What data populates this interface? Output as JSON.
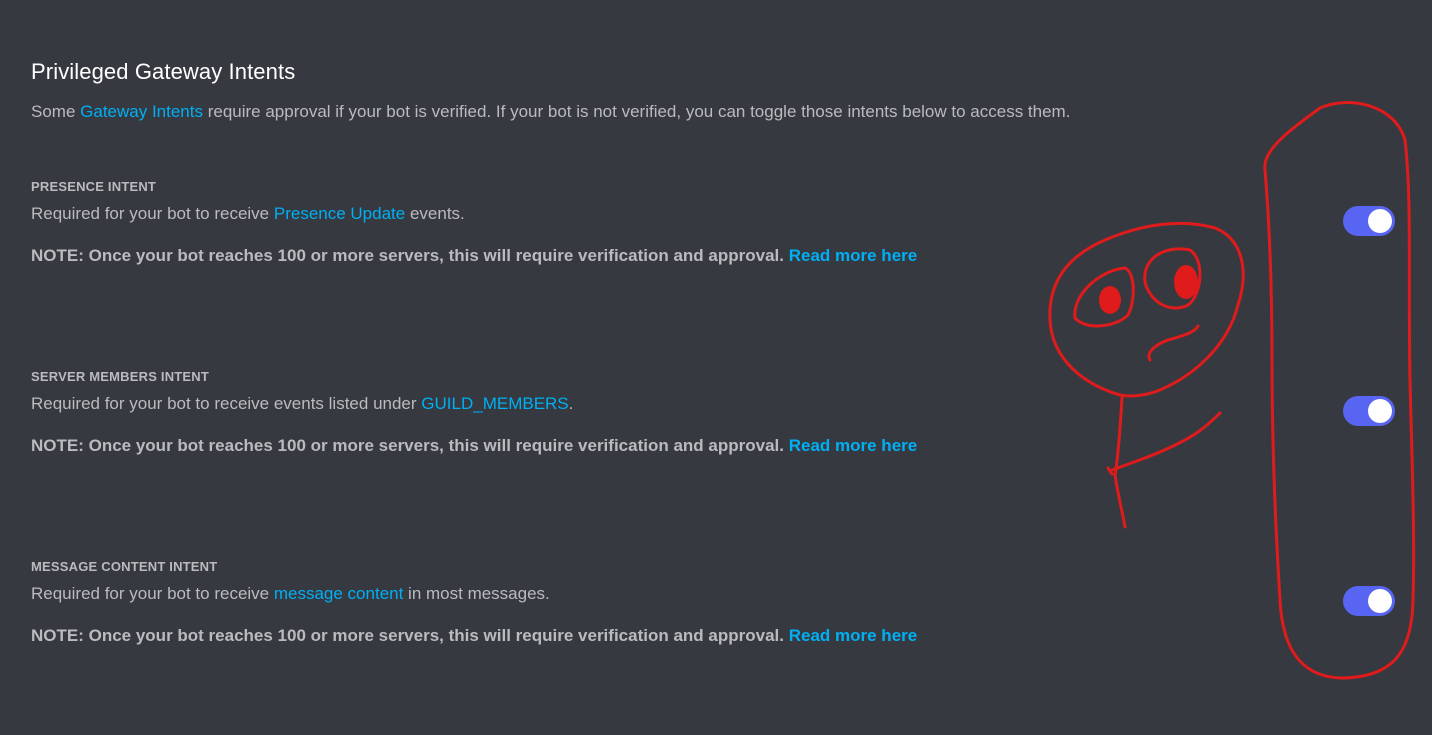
{
  "header": {
    "title": "Privileged Gateway Intents",
    "subtitle_prefix": "Some ",
    "subtitle_link": "Gateway Intents",
    "subtitle_suffix": " require approval if your bot is verified. If your bot is not verified, you can toggle those intents below to access them."
  },
  "intents": [
    {
      "title": "PRESENCE INTENT",
      "desc_prefix": "Required for your bot to receive ",
      "desc_link": "Presence Update",
      "desc_suffix": " events.",
      "note": "NOTE: Once your bot reaches 100 or more servers, this will require verification and approval.",
      "note_link": "Read more here",
      "enabled": true
    },
    {
      "title": "SERVER MEMBERS INTENT",
      "desc_prefix": "Required for your bot to receive events listed under ",
      "desc_link": "GUILD_MEMBERS",
      "desc_suffix": ".",
      "note": "NOTE: Once your bot reaches 100 or more servers, this will require verification and approval.",
      "note_link": "Read more here",
      "enabled": true
    },
    {
      "title": "MESSAGE CONTENT INTENT",
      "desc_prefix": "Required for your bot to receive ",
      "desc_link": "message content",
      "desc_suffix": " in most messages.",
      "note": "NOTE: Once your bot reaches 100 or more servers, this will require verification and approval.",
      "note_link": "Read more here",
      "enabled": true
    }
  ],
  "colors": {
    "background": "#36393f",
    "link": "#00aff4",
    "toggle_on": "#5865f2",
    "annotation": "#e01b1b"
  }
}
